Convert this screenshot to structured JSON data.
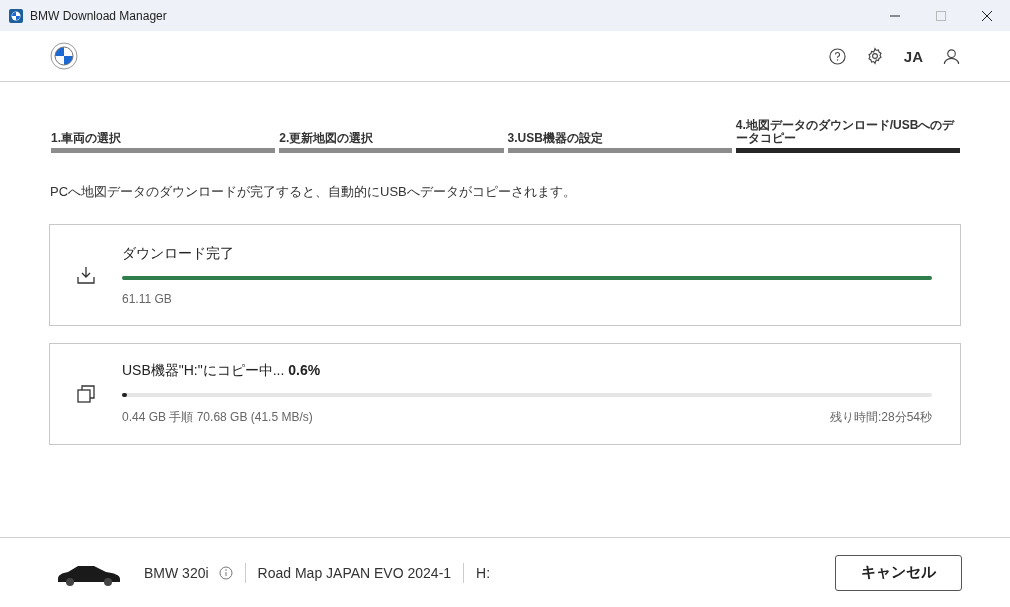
{
  "window": {
    "title": "BMW Download Manager"
  },
  "header": {
    "language": "JA"
  },
  "steps": [
    {
      "label": "1.車両の選択",
      "selected": false
    },
    {
      "label": "2.更新地図の選択",
      "selected": false
    },
    {
      "label": "3.USB機器の設定",
      "selected": false
    },
    {
      "label": "4.地図データのダウンロード/USBへのデータコピー",
      "selected": true
    }
  ],
  "message": "PCへ地図データのダウンロードが完了すると、自動的にUSBへデータがコピーされます。",
  "tasks": [
    {
      "kind": "download",
      "title": "ダウンロード完了",
      "level": 1,
      "detail": "61.11 GB",
      "color": "#2e7d4a"
    },
    {
      "kind": "copy",
      "title": "USB機器\"H:\"にコピー中... **0.6%**",
      "level": 0.006,
      "detail": "0.44 GB 手順 70.68 GB (41.5 MB/s)",
      "remaining": "残り時間:28分54秒",
      "color": "#222222"
    }
  ],
  "footer": {
    "vehicle": "BMW 320i",
    "map": "Road Map JAPAN EVO 2024-1",
    "drive": "H:",
    "cancel": "キャンセル"
  }
}
